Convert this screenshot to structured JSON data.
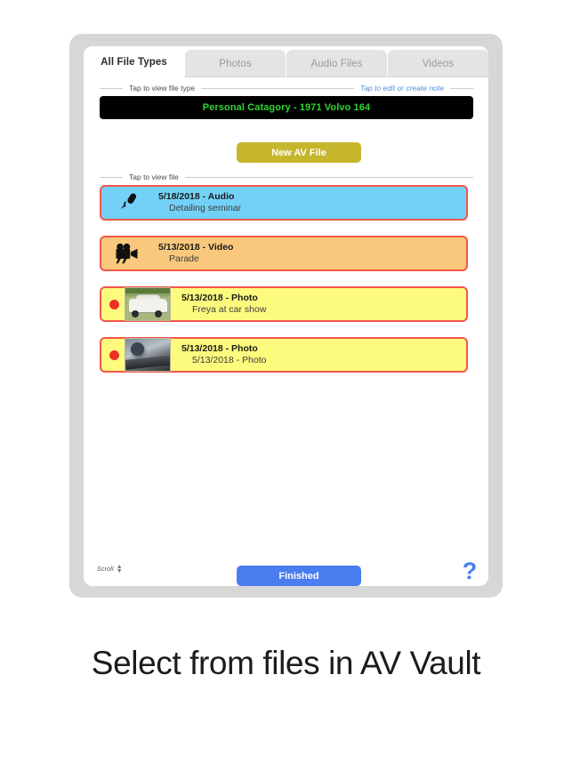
{
  "tabs": [
    {
      "label": "All File Types",
      "active": true
    },
    {
      "label": "Photos",
      "active": false
    },
    {
      "label": "Audio Files",
      "active": false
    },
    {
      "label": "Videos",
      "active": false
    }
  ],
  "hints": {
    "file_type": "Tap to view file type",
    "edit_note": "Tap to edit or create note",
    "view_file": "Tap to view file"
  },
  "category": {
    "text": "Personal Catagory - 1971 Volvo 164",
    "text_color": "#2fd62f",
    "background": "#000000"
  },
  "new_av_file_button": {
    "label": "New AV File",
    "background": "#c6b62c"
  },
  "files": [
    {
      "title": "5/18/2018 - Audio",
      "subtitle": "Detailing seminar",
      "kind": "audio",
      "icon": "microphone-icon",
      "background": "#73d1f7",
      "border": "#f2574a",
      "has_dot": false,
      "has_thumbnail": false
    },
    {
      "title": "5/13/2018 - Video",
      "subtitle": "Parade",
      "kind": "video",
      "icon": "movie-camera-icon",
      "background": "#fac87c",
      "border": "#f2574a",
      "has_dot": false,
      "has_thumbnail": false
    },
    {
      "title": "5/13/2018 - Photo",
      "subtitle": "Freya at car show",
      "kind": "photo",
      "icon": "photo-thumbnail",
      "background": "#fdfb7d",
      "border": "#f2574a",
      "has_dot": true,
      "has_thumbnail": true
    },
    {
      "title": "5/13/2018 - Photo",
      "subtitle": "5/13/2018 - Photo",
      "kind": "photo",
      "icon": "photo-thumbnail",
      "background": "#fdfb7d",
      "border": "#f2574a",
      "has_dot": true,
      "has_thumbnail": true
    }
  ],
  "footer": {
    "scroll_label": "Scroll",
    "finished_label": "Finished",
    "finished_color": "#4a7df0",
    "help_label": "?",
    "help_color": "#4a7df0"
  },
  "caption": "Select from files in AV Vault"
}
